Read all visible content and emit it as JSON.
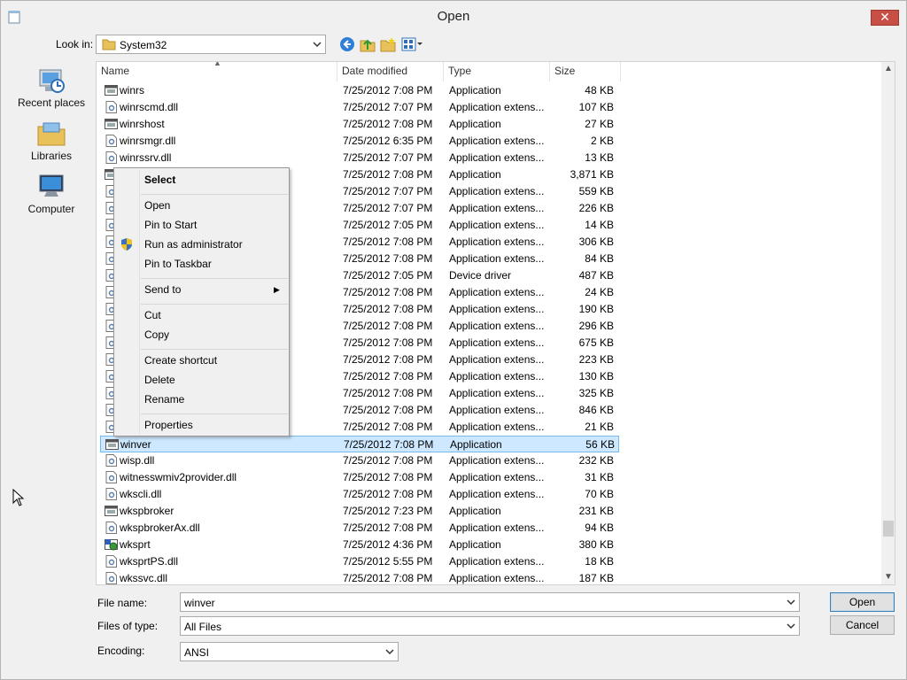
{
  "window": {
    "title": "Open"
  },
  "toolbar": {
    "look_in_label": "Look in:",
    "look_in_value": "System32"
  },
  "places": [
    {
      "label": "Recent places",
      "icon": "recent-places-icon"
    },
    {
      "label": "Libraries",
      "icon": "libraries-icon"
    },
    {
      "label": "Computer",
      "icon": "computer-icon"
    }
  ],
  "columns": {
    "name": "Name",
    "date": "Date modified",
    "type": "Type",
    "size": "Size"
  },
  "files": [
    {
      "name": "winrs",
      "date": "7/25/2012 7:08 PM",
      "type": "Application",
      "size": "48 KB",
      "icon": "exe-icon"
    },
    {
      "name": "winrscmd.dll",
      "date": "7/25/2012 7:07 PM",
      "type": "Application extens...",
      "size": "107 KB",
      "icon": "dll-icon"
    },
    {
      "name": "winrshost",
      "date": "7/25/2012 7:08 PM",
      "type": "Application",
      "size": "27 KB",
      "icon": "exe-icon"
    },
    {
      "name": "winrsmgr.dll",
      "date": "7/25/2012 6:35 PM",
      "type": "Application extens...",
      "size": "2 KB",
      "icon": "dll-icon"
    },
    {
      "name": "winrssrv.dll",
      "date": "7/25/2012 7:07 PM",
      "type": "Application extens...",
      "size": "13 KB",
      "icon": "dll-icon"
    },
    {
      "name": "",
      "date": "7/25/2012 7:08 PM",
      "type": "Application",
      "size": "3,871 KB",
      "icon": "exe-icon"
    },
    {
      "name": "",
      "date": "7/25/2012 7:07 PM",
      "type": "Application extens...",
      "size": "559 KB",
      "icon": "dll-icon"
    },
    {
      "name": "",
      "date": "7/25/2012 7:07 PM",
      "type": "Application extens...",
      "size": "226 KB",
      "icon": "dll-icon"
    },
    {
      "name": "",
      "date": "7/25/2012 7:05 PM",
      "type": "Application extens...",
      "size": "14 KB",
      "icon": "dll-icon"
    },
    {
      "name": "",
      "date": "7/25/2012 7:08 PM",
      "type": "Application extens...",
      "size": "306 KB",
      "icon": "dll-icon"
    },
    {
      "name": "",
      "date": "7/25/2012 7:08 PM",
      "type": "Application extens...",
      "size": "84 KB",
      "icon": "dll-icon"
    },
    {
      "name": "",
      "date": "7/25/2012 7:05 PM",
      "type": "Device driver",
      "size": "487 KB",
      "icon": "sys-icon"
    },
    {
      "name": "",
      "date": "7/25/2012 7:08 PM",
      "type": "Application extens...",
      "size": "24 KB",
      "icon": "dll-icon"
    },
    {
      "name": "",
      "date": "7/25/2012 7:08 PM",
      "type": "Application extens...",
      "size": "190 KB",
      "icon": "dll-icon"
    },
    {
      "name": "",
      "date": "7/25/2012 7:08 PM",
      "type": "Application extens...",
      "size": "296 KB",
      "icon": "dll-icon"
    },
    {
      "name": "",
      "date": "7/25/2012 7:08 PM",
      "type": "Application extens...",
      "size": "675 KB",
      "icon": "dll-icon"
    },
    {
      "name": "",
      "date": "7/25/2012 7:08 PM",
      "type": "Application extens...",
      "size": "223 KB",
      "icon": "dll-icon"
    },
    {
      "name": "",
      "date": "7/25/2012 7:08 PM",
      "type": "Application extens...",
      "size": "130 KB",
      "icon": "dll-icon"
    },
    {
      "name": "",
      "date": "7/25/2012 7:08 PM",
      "type": "Application extens...",
      "size": "325 KB",
      "icon": "dll-icon"
    },
    {
      "name": "",
      "date": "7/25/2012 7:08 PM",
      "type": "Application extens...",
      "size": "846 KB",
      "icon": "dll-icon"
    },
    {
      "name": "",
      "date": "7/25/2012 7:08 PM",
      "type": "Application extens...",
      "size": "21 KB",
      "icon": "dll-icon"
    },
    {
      "name": "winver",
      "date": "7/25/2012 7:08 PM",
      "type": "Application",
      "size": "56 KB",
      "icon": "exe-icon",
      "selected": true
    },
    {
      "name": "wisp.dll",
      "date": "7/25/2012 7:08 PM",
      "type": "Application extens...",
      "size": "232 KB",
      "icon": "dll-icon"
    },
    {
      "name": "witnesswmiv2provider.dll",
      "date": "7/25/2012 7:08 PM",
      "type": "Application extens...",
      "size": "31 KB",
      "icon": "dll-icon"
    },
    {
      "name": "wkscli.dll",
      "date": "7/25/2012 7:08 PM",
      "type": "Application extens...",
      "size": "70 KB",
      "icon": "dll-icon"
    },
    {
      "name": "wkspbroker",
      "date": "7/25/2012 7:23 PM",
      "type": "Application",
      "size": "231 KB",
      "icon": "exe-icon"
    },
    {
      "name": "wkspbrokerAx.dll",
      "date": "7/25/2012 7:08 PM",
      "type": "Application extens...",
      "size": "94 KB",
      "icon": "dll-icon"
    },
    {
      "name": "wksprt",
      "date": "7/25/2012 4:36 PM",
      "type": "Application",
      "size": "380 KB",
      "icon": "app-globe-icon"
    },
    {
      "name": "wksprtPS.dll",
      "date": "7/25/2012 5:55 PM",
      "type": "Application extens...",
      "size": "18 KB",
      "icon": "dll-icon"
    },
    {
      "name": "wkssvc.dll",
      "date": "7/25/2012 7:08 PM",
      "type": "Application extens...",
      "size": "187 KB",
      "icon": "dll-icon"
    }
  ],
  "context_menu": {
    "items": [
      {
        "label": "Select",
        "bold": true
      },
      {
        "separator": true
      },
      {
        "label": "Open"
      },
      {
        "label": "Pin to Start"
      },
      {
        "label": "Run as administrator",
        "icon": "uac-shield-icon"
      },
      {
        "label": "Pin to Taskbar"
      },
      {
        "separator": true
      },
      {
        "label": "Send to",
        "submenu": true
      },
      {
        "separator": true
      },
      {
        "label": "Cut"
      },
      {
        "label": "Copy"
      },
      {
        "separator": true
      },
      {
        "label": "Create shortcut"
      },
      {
        "label": "Delete"
      },
      {
        "label": "Rename"
      },
      {
        "separator": true
      },
      {
        "label": "Properties"
      }
    ]
  },
  "bottom": {
    "file_name_label": "File name:",
    "file_name_value": "winver",
    "files_of_type_label": "Files of type:",
    "files_of_type_value": "All Files",
    "encoding_label": "Encoding:",
    "encoding_value": "ANSI",
    "open_button": "Open",
    "cancel_button": "Cancel"
  },
  "colors": {
    "selection": "#cde8ff",
    "close_button": "#c74f45",
    "dialog_background": "#f0f0f0"
  }
}
